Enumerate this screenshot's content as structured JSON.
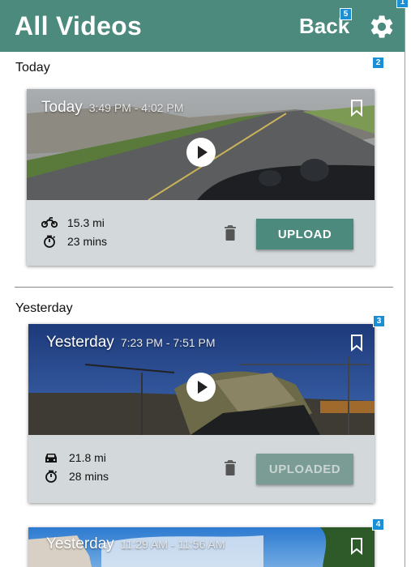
{
  "header": {
    "title": "All Videos",
    "back_label": "Back"
  },
  "badges": {
    "settings": "1",
    "today_section": "2",
    "yesterday_card_1": "3",
    "yesterday_card_2": "4",
    "back": "5"
  },
  "sections": [
    {
      "label": "Today"
    },
    {
      "label": "Yesterday"
    }
  ],
  "cards": [
    {
      "day": "Today",
      "time": "3:49 PM - 4:02 PM",
      "vehicle_icon": "motorcycle-icon",
      "distance": "15.3 mi",
      "duration": "23 mins",
      "action_label": "UPLOAD",
      "uploaded": false
    },
    {
      "day": "Yesterday",
      "time": "7:23 PM - 7:51 PM",
      "vehicle_icon": "car-icon",
      "distance": "21.8 mi",
      "duration": "28 mins",
      "action_label": "UPLOADED",
      "uploaded": true
    },
    {
      "day": "Yesterday",
      "time": "11:29 AM - 11:56 AM"
    }
  ],
  "colors": {
    "header": "#4b8a7d",
    "button": "#4b8a7d",
    "button_done": "#7b9c95",
    "card_footer": "#d3d9db",
    "badge": "#1b8fd6"
  }
}
